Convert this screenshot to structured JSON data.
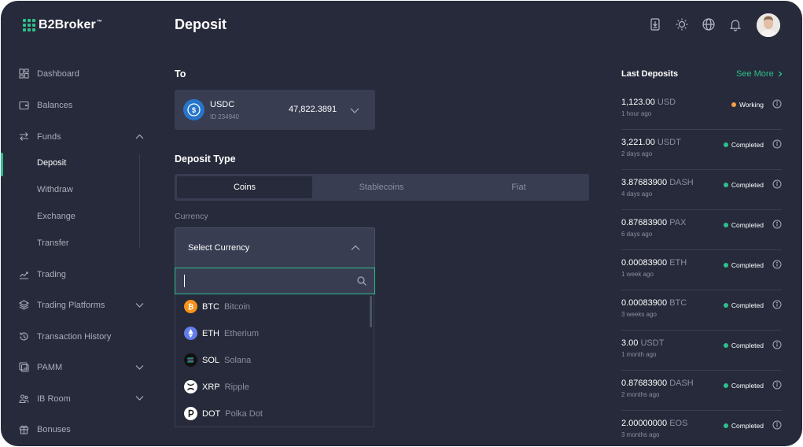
{
  "brand": {
    "name": "B2Broker",
    "tm": "™",
    "accent": "#2ec08a"
  },
  "page": {
    "title": "Deposit"
  },
  "header": {
    "icons": [
      "download-icon",
      "sun-icon",
      "globe-icon",
      "bell-icon"
    ]
  },
  "sidebar": {
    "items": [
      {
        "label": "Dashboard",
        "icon": "dashboard-icon"
      },
      {
        "label": "Balances",
        "icon": "wallet-icon"
      },
      {
        "label": "Funds",
        "icon": "transfer-icon",
        "expanded": true
      },
      {
        "label": "Trading",
        "icon": "chart-line-icon"
      },
      {
        "label": "Trading Platforms",
        "icon": "layers-icon"
      },
      {
        "label": "Transaction History",
        "icon": "history-icon"
      },
      {
        "label": "PAMM",
        "icon": "pamm-icon"
      },
      {
        "label": "IB Room",
        "icon": "users-icon"
      },
      {
        "label": "Bonuses",
        "icon": "gift-icon"
      }
    ],
    "funds_sub": [
      "Deposit",
      "Withdraw",
      "Exchange",
      "Transfer"
    ]
  },
  "to": {
    "label": "To",
    "account_name": "USDC",
    "account_id": "ID 234940",
    "amount": "47,822.3891"
  },
  "deposit_type": {
    "label": "Deposit Type",
    "tabs": [
      "Coins",
      "Stablecoins",
      "Fiat"
    ],
    "active": "Coins"
  },
  "currency": {
    "label": "Currency",
    "select_text": "Select Currency",
    "search_value": "",
    "options": [
      {
        "code": "BTC",
        "name": "Bitcoin",
        "color": "#f7931a"
      },
      {
        "code": "ETH",
        "name": "Etherium",
        "color": "#627eea"
      },
      {
        "code": "SOL",
        "name": "Solana",
        "color": "#111111"
      },
      {
        "code": "XRP",
        "name": "Ripple",
        "color": "#ffffff"
      },
      {
        "code": "DOT",
        "name": "Polka Dot",
        "color": "#ffffff"
      }
    ]
  },
  "last_deposits": {
    "title": "Last Deposits",
    "see_more": "See More",
    "items": [
      {
        "amount": "1,123.00",
        "currency": "USD",
        "time": "1 hour ago",
        "status": "Working",
        "status_color": "#f5a04a"
      },
      {
        "amount": "3,221.00",
        "currency": "USDT",
        "time": "2 days ago",
        "status": "Completed",
        "status_color": "#2ec08a"
      },
      {
        "amount": "3.87683900",
        "currency": "DASH",
        "time": "4 days ago",
        "status": "Completed",
        "status_color": "#2ec08a"
      },
      {
        "amount": "0.87683900",
        "currency": "PAX",
        "time": "6 days ago",
        "status": "Completed",
        "status_color": "#2ec08a"
      },
      {
        "amount": "0.00083900",
        "currency": "ETH",
        "time": "1 week ago",
        "status": "Completed",
        "status_color": "#2ec08a"
      },
      {
        "amount": "0.00083900",
        "currency": "BTC",
        "time": "3 weeks ago",
        "status": "Completed",
        "status_color": "#2ec08a"
      },
      {
        "amount": "3.00",
        "currency": "USDT",
        "time": "1 month ago",
        "status": "Completed",
        "status_color": "#2ec08a"
      },
      {
        "amount": "0.87683900",
        "currency": "DASH",
        "time": "2 months ago",
        "status": "Completed",
        "status_color": "#2ec08a"
      },
      {
        "amount": "2.00000000",
        "currency": "EOS",
        "time": "3 months ago",
        "status": "Completed",
        "status_color": "#2ec08a"
      }
    ]
  }
}
